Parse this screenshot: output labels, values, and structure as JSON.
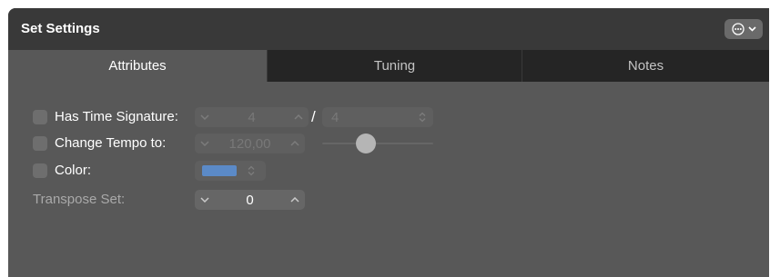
{
  "window": {
    "title": "Set Settings",
    "menu_icon": "ellipsis-circle-icon"
  },
  "tabs": [
    {
      "label": "Attributes",
      "active": true
    },
    {
      "label": "Tuning",
      "active": false
    },
    {
      "label": "Notes",
      "active": false
    }
  ],
  "attributes": {
    "time_signature": {
      "label": "Has Time Signature:",
      "checked": false,
      "numerator": "4",
      "denominator": "4",
      "separator": "/"
    },
    "tempo": {
      "label": "Change Tempo to:",
      "checked": false,
      "value": "120,00"
    },
    "color": {
      "label": "Color:",
      "checked": false,
      "swatch": "#5b8ac7"
    },
    "transpose": {
      "label": "Transpose Set:",
      "value": "0"
    }
  },
  "colors": {
    "panel": "#585858",
    "titlebar": "#393939",
    "inactive_tab": "#252525"
  }
}
